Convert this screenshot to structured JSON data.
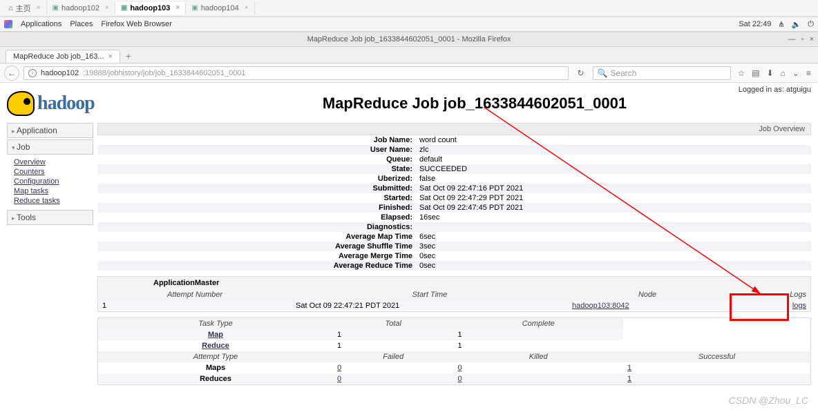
{
  "ide_tabs": [
    {
      "label": "主页",
      "icon": "home",
      "active": false
    },
    {
      "label": "hadoop102",
      "icon": "term",
      "active": false
    },
    {
      "label": "hadoop103",
      "icon": "term",
      "active": true
    },
    {
      "label": "hadoop104",
      "icon": "term",
      "active": false
    }
  ],
  "gnome": {
    "apps": "Applications",
    "places": "Places",
    "browser": "Firefox Web Browser",
    "clock": "Sat 22:49"
  },
  "ff": {
    "window_title": "MapReduce Job job_1633844602051_0001 - Mozilla Firefox",
    "tab_title": "MapReduce Job job_163...",
    "url_domain": "hadoop102",
    "url_port_path": ":19888/jobhistory/job/job_1633844602051_0001",
    "search_placeholder": "Search"
  },
  "page": {
    "title": "MapReduce Job job_1633844602051_0001",
    "logged_in": "Logged in as: atguigu",
    "overview_label": "Job Overview"
  },
  "side": {
    "application": "Application",
    "job": "Job",
    "tools": "Tools",
    "links": [
      "Overview",
      "Counters",
      "Configuration",
      "Map tasks",
      "Reduce tasks"
    ]
  },
  "kv": [
    {
      "k": "Job Name:",
      "v": "word count"
    },
    {
      "k": "User Name:",
      "v": "zlc"
    },
    {
      "k": "Queue:",
      "v": "default"
    },
    {
      "k": "State:",
      "v": "SUCCEEDED"
    },
    {
      "k": "Uberized:",
      "v": "false"
    },
    {
      "k": "Submitted:",
      "v": "Sat Oct 09 22:47:16 PDT 2021"
    },
    {
      "k": "Started:",
      "v": "Sat Oct 09 22:47:29 PDT 2021"
    },
    {
      "k": "Finished:",
      "v": "Sat Oct 09 22:47:45 PDT 2021"
    },
    {
      "k": "Elapsed:",
      "v": "16sec"
    },
    {
      "k": "Diagnostics:",
      "v": ""
    },
    {
      "k": "Average Map Time",
      "v": "6sec"
    },
    {
      "k": "Average Shuffle Time",
      "v": "3sec"
    },
    {
      "k": "Average Merge Time",
      "v": "0sec"
    },
    {
      "k": "Average Reduce Time",
      "v": "0sec"
    }
  ],
  "appmaster": {
    "title": "ApplicationMaster",
    "headers": [
      "Attempt Number",
      "Start Time",
      "Node",
      "Logs"
    ],
    "row": {
      "attempt": "1",
      "start": "Sat Oct 09 22:47:21 PDT 2021",
      "node": "hadoop103:8042",
      "logs": "logs"
    }
  },
  "tasktype": {
    "headers": [
      "Task Type",
      "Total",
      "Complete"
    ],
    "rows": [
      {
        "type": "Map",
        "total": "1",
        "complete": "1"
      },
      {
        "type": "Reduce",
        "total": "1",
        "complete": "1"
      }
    ]
  },
  "attempttype": {
    "headers": [
      "Attempt Type",
      "Failed",
      "Killed",
      "Successful"
    ],
    "rows": [
      {
        "type": "Maps",
        "f": "0",
        "k": "0",
        "s": "1"
      },
      {
        "type": "Reduces",
        "f": "0",
        "k": "0",
        "s": "1"
      }
    ]
  },
  "watermark": "CSDN @Zhou_LC"
}
